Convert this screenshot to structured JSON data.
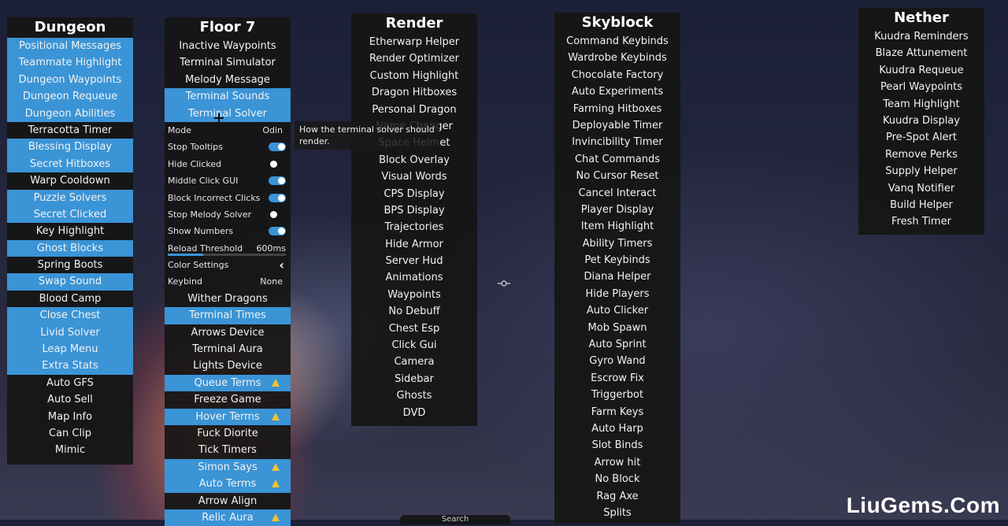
{
  "dungeon": {
    "title": "Dungeon",
    "items": [
      {
        "label": "Positional Messages",
        "on": true
      },
      {
        "label": "Teammate Highlight",
        "on": true
      },
      {
        "label": "Dungeon Waypoints",
        "on": true
      },
      {
        "label": "Dungeon Requeue",
        "on": true
      },
      {
        "label": "Dungeon Abilities",
        "on": true
      },
      {
        "label": "Terracotta Timer",
        "on": false
      },
      {
        "label": "Blessing Display",
        "on": true
      },
      {
        "label": "Secret Hitboxes",
        "on": true
      },
      {
        "label": "Warp Cooldown",
        "on": false
      },
      {
        "label": "Puzzle Solvers",
        "on": true
      },
      {
        "label": "Secret Clicked",
        "on": true
      },
      {
        "label": "Key Highlight",
        "on": false
      },
      {
        "label": "Ghost Blocks",
        "on": true
      },
      {
        "label": "Spring Boots",
        "on": false
      },
      {
        "label": "Swap Sound",
        "on": true
      },
      {
        "label": "Blood Camp",
        "on": false
      },
      {
        "label": "Close Chest",
        "on": true
      },
      {
        "label": "Livid Solver",
        "on": true
      },
      {
        "label": "Leap Menu",
        "on": true
      },
      {
        "label": "Extra Stats",
        "on": true
      },
      {
        "label": "Auto GFS",
        "on": false
      },
      {
        "label": "Auto Sell",
        "on": false
      },
      {
        "label": "Map Info",
        "on": false
      },
      {
        "label": "Can Clip",
        "on": false
      },
      {
        "label": "Mimic",
        "on": false
      }
    ]
  },
  "floor7": {
    "title": "Floor 7",
    "items_top": [
      {
        "label": "Inactive Waypoints",
        "on": false
      },
      {
        "label": "Terminal Simulator",
        "on": false
      },
      {
        "label": "Melody Message",
        "on": false
      },
      {
        "label": "Terminal Sounds",
        "on": true
      },
      {
        "label": "Terminal Solver",
        "on": true
      }
    ],
    "options": [
      {
        "label": "Mode",
        "kind": "value",
        "value": "Odin"
      },
      {
        "label": "Stop Tooltips",
        "kind": "toggle",
        "enabled": true
      },
      {
        "label": "Hide Clicked",
        "kind": "toggle",
        "enabled": false
      },
      {
        "label": "Middle Click GUI",
        "kind": "toggle",
        "enabled": true
      },
      {
        "label": "Block Incorrect Clicks",
        "kind": "toggle",
        "enabled": true
      },
      {
        "label": "Stop Melody Solver",
        "kind": "toggle",
        "enabled": false
      },
      {
        "label": "Show Numbers",
        "kind": "toggle",
        "enabled": true
      },
      {
        "label": "Reload Threshold",
        "kind": "slider",
        "value": "600ms",
        "fraction": 0.3
      },
      {
        "label": "Color Settings",
        "kind": "chevron"
      },
      {
        "label": "Keybind",
        "kind": "value",
        "value": "None"
      }
    ],
    "items_bottom": [
      {
        "label": "Wither Dragons",
        "on": false,
        "warn": false
      },
      {
        "label": "Terminal Times",
        "on": true,
        "warn": false
      },
      {
        "label": "Arrows Device",
        "on": false,
        "warn": false
      },
      {
        "label": "Terminal Aura",
        "on": false,
        "warn": false
      },
      {
        "label": "Lights Device",
        "on": false,
        "warn": false
      },
      {
        "label": "Queue Terms",
        "on": true,
        "warn": true
      },
      {
        "label": "Freeze Game",
        "on": false,
        "warn": false
      },
      {
        "label": "Hover Terms",
        "on": true,
        "warn": true
      },
      {
        "label": "Fuck Diorite",
        "on": false,
        "warn": false
      },
      {
        "label": "Tick Timers",
        "on": false,
        "warn": false
      },
      {
        "label": "Simon Says",
        "on": true,
        "warn": true
      },
      {
        "label": "Auto Terms",
        "on": true,
        "warn": true
      },
      {
        "label": "Arrow Align",
        "on": false,
        "warn": false
      },
      {
        "label": "Relic Aura",
        "on": true,
        "warn": true
      }
    ]
  },
  "tooltip": "How the terminal solver should render.",
  "render": {
    "title": "Render",
    "items": [
      "Etherwarp Helper",
      "Render Optimizer",
      "Custom Highlight",
      "Dragon Hitboxes",
      "Personal Dragon",
      "Name Changer",
      "Space Helmet",
      "Block Overlay",
      "Visual Words",
      "CPS Display",
      "BPS Display",
      "Trajectories",
      "Hide Armor",
      "Server Hud",
      "Animations",
      "Waypoints",
      "No Debuff",
      "Chest Esp",
      "Click Gui",
      "Camera",
      "Sidebar",
      "Ghosts",
      "DVD"
    ]
  },
  "skyblock": {
    "title": "Skyblock",
    "items": [
      "Command Keybinds",
      "Wardrobe Keybinds",
      "Chocolate Factory",
      "Auto Experiments",
      "Farming Hitboxes",
      "Deployable Timer",
      "Invincibility Timer",
      "Chat Commands",
      "No Cursor Reset",
      "Cancel Interact",
      "Player Display",
      "Item Highlight",
      "Ability Timers",
      "Pet Keybinds",
      "Diana Helper",
      "Hide Players",
      "Auto Clicker",
      "Mob Spawn",
      "Auto Sprint",
      "Gyro Wand",
      "Escrow Fix",
      "Triggerbot",
      "Farm Keys",
      "Auto Harp",
      "Slot Binds",
      "Arrow hit",
      "No Block",
      "Rag Axe",
      "Splits"
    ]
  },
  "nether": {
    "title": "Nether",
    "items": [
      "Kuudra Reminders",
      "Blaze Attunement",
      "Kuudra Requeue",
      "Pearl Waypoints",
      "Team Highlight",
      "Kuudra Display",
      "Pre-Spot Alert",
      "Remove Perks",
      "Supply Helper",
      "Vanq Notifier",
      "Build Helper",
      "Fresh Timer"
    ]
  },
  "search_hint": "Search",
  "watermark": "LiuGems.Com"
}
